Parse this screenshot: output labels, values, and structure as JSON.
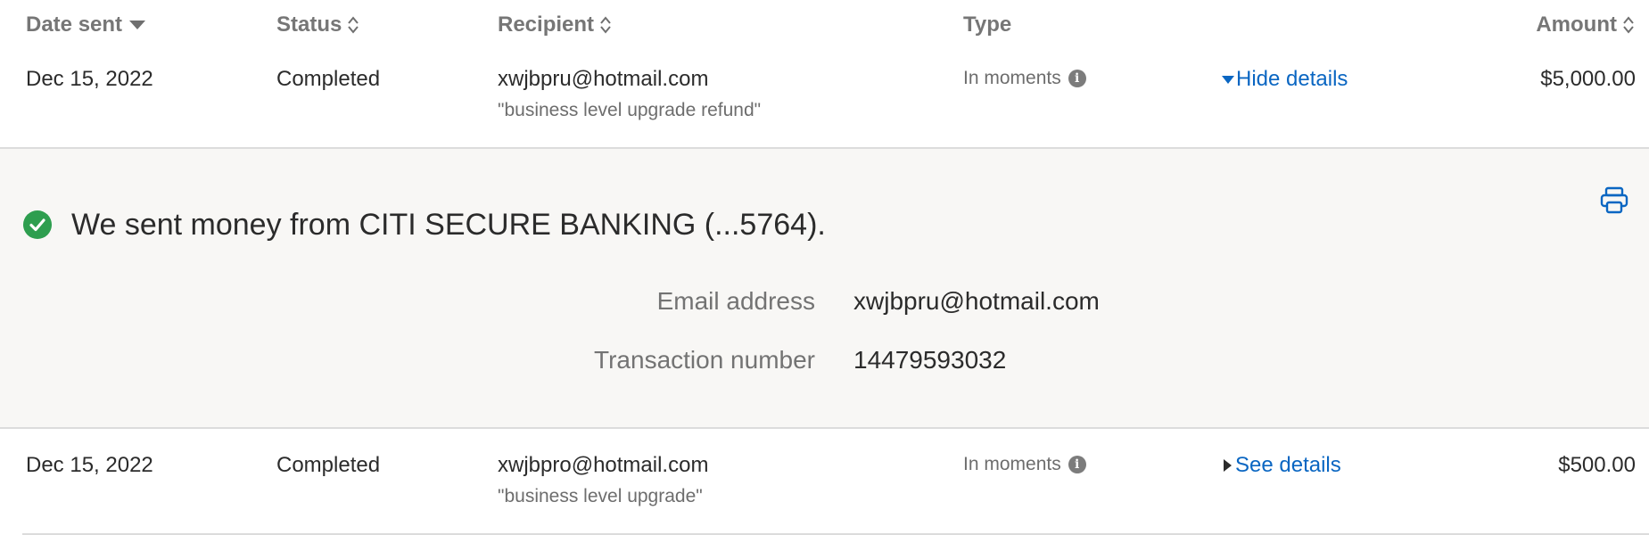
{
  "header": {
    "date_sent": "Date sent",
    "status": "Status",
    "recipient": "Recipient",
    "type": "Type",
    "amount": "Amount"
  },
  "transactions": [
    {
      "date": "Dec 15, 2022",
      "status": "Completed",
      "recipient": "xwjbpru@hotmail.com",
      "memo": "\"business level upgrade refund\"",
      "type": "In moments",
      "details_link": "Hide details",
      "amount": "$5,000.00"
    },
    {
      "date": "Dec 15, 2022",
      "status": "Completed",
      "recipient": "xwjbpro@hotmail.com",
      "memo": "\"business level upgrade\"",
      "type": "In moments",
      "details_link": "See details",
      "amount": "$500.00"
    }
  ],
  "details": {
    "headline": "We sent money from CITI SECURE BANKING (...5764).",
    "email_label": "Email address",
    "email_value": "xwjbpru@hotmail.com",
    "txn_label": "Transaction number",
    "txn_value": "14479593032"
  },
  "colors": {
    "link": "#0a66c2",
    "success": "#2e9e4f",
    "panel_bg": "#f8f7f5"
  }
}
